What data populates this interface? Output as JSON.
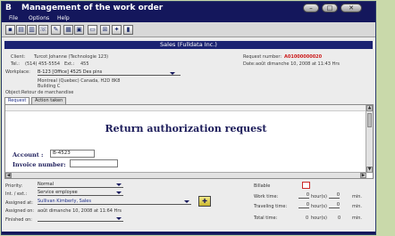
{
  "window": {
    "title": "Management of the work order",
    "app_icon": "B",
    "minimize_icon": "–",
    "maximize_icon": "□",
    "close_icon": "✕"
  },
  "menu": {
    "file": "File",
    "options": "Options",
    "help": "Help"
  },
  "toolbar": {
    "buttons": [
      {
        "name": "save-icon",
        "glyph": "▪"
      },
      {
        "name": "document-icon",
        "glyph": "▤"
      },
      {
        "name": "print-icon",
        "glyph": "▥"
      },
      {
        "name": "telephone-icon",
        "glyph": "☏"
      },
      {
        "name": "tools-icon",
        "glyph": "✎"
      },
      {
        "name": "calendar-icon",
        "glyph": "▦"
      },
      {
        "name": "stamp-icon",
        "glyph": "▣"
      },
      {
        "name": "folder-icon",
        "glyph": "▭"
      },
      {
        "name": "attachment-icon",
        "glyph": "⊞"
      },
      {
        "name": "lightbulb-icon",
        "glyph": "✦"
      },
      {
        "name": "bar-chart-icon",
        "glyph": "▮"
      }
    ]
  },
  "department_bar": "Sales (Fulldata Inc.)",
  "client": {
    "client_label": "Client:",
    "client_value": "Turcot Johanne (Technologie 123)",
    "tel_label": "Tel.:",
    "tel_value": "(514) 455-5554",
    "ext_label": "Ext.:",
    "ext_value": "455",
    "workplace_label": "Workplace:",
    "workplace_value": "B-123 [Office]  4525 Des pins",
    "address_line1": "Montreal (Quebec) Canada,  H2D 8K8",
    "address_line2": "Building C",
    "request_number_label": "Request number:",
    "request_number_value": "A01000000020",
    "date_label": "Date:",
    "date_value": "août dimanche 10, 2008 at 11:43 Hrs",
    "object_label": "Object:",
    "object_value": "Retour de marchandise"
  },
  "tabs": {
    "request": "Request",
    "action_taken": "Action taken"
  },
  "document": {
    "title": "Return authorization request",
    "account_label": "Account :",
    "account_value": "B-4523",
    "invoice_label": "Invoice number:",
    "invoice_value": "",
    "scroll_up": "▲",
    "scroll_down": "▼",
    "scroll_left": "◀",
    "scroll_right": "▶"
  },
  "details": {
    "priority_label": "Priority:",
    "priority_value": "Normal",
    "int_ext_label": "Int. / ext.:",
    "int_ext_value": "Service employee",
    "assigned_at_label": "Assigned at:",
    "assigned_at_value": "Sullivan Kimberly, Sales",
    "assigned_on_label": "Assigned on:",
    "assigned_on_value": "août dimanche 10, 2008 at 11:64 Hrs",
    "finished_on_label": "Finished on:",
    "finished_on_value": "",
    "billable_label": "Billable",
    "work_time_label": "Work time:",
    "work_time_hours": "0",
    "work_time_minutes": "0",
    "traveling_time_label": "Traveling time:",
    "traveling_time_hours": "0",
    "traveling_time_minutes": "0",
    "total_time_label": "Total time:",
    "total_time_hours": "0",
    "total_time_minutes": "0",
    "hours_unit": "hour(s)",
    "min_unit": "min.",
    "add_button_glyph": "✚"
  },
  "colors": {
    "title_bar": "#14175c",
    "department_bar": "#1c2472",
    "request_number": "#cc1a1a",
    "background": "#c9d9aa"
  }
}
